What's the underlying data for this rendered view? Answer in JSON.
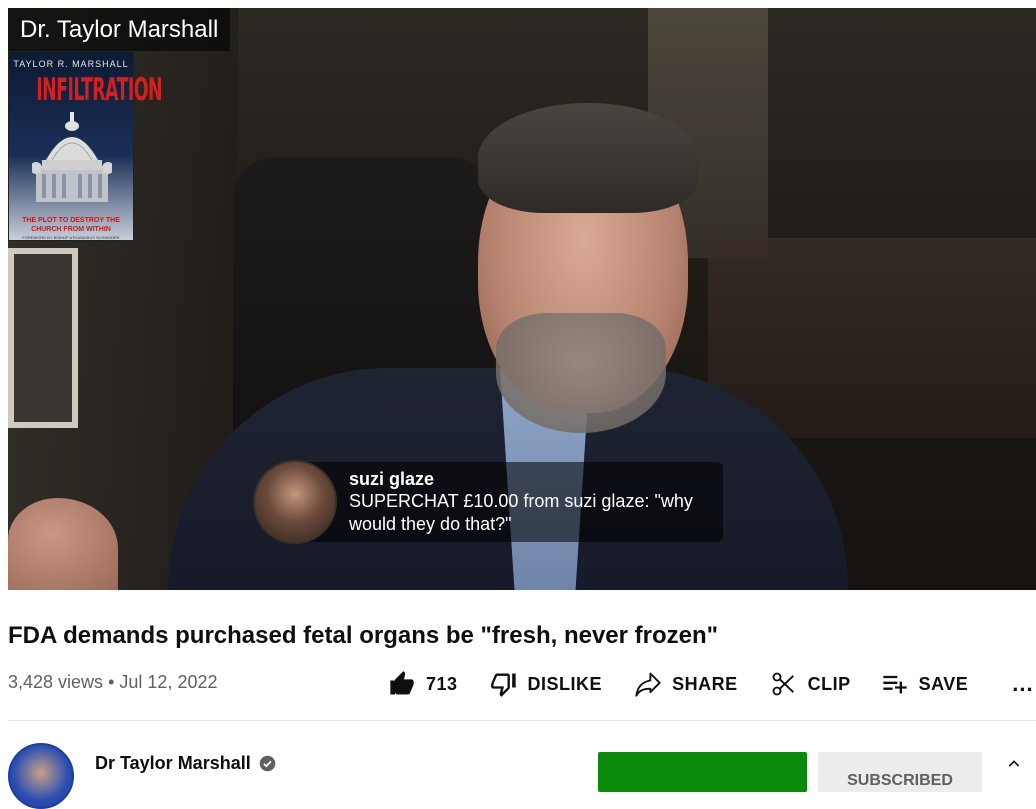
{
  "video": {
    "channel_overlay": "Dr. Taylor Marshall",
    "book": {
      "author": "TAYLOR R. MARSHALL",
      "title": "INFILTRATION",
      "subtitle_line1": "THE PLOT TO DESTROY THE",
      "subtitle_line2": "CHURCH FROM WITHIN",
      "foreword": "FOREWORD BY BISHOP ATHANASIUS SCHNEIDER"
    },
    "superchat": {
      "name": "suzi glaze",
      "message": "SUPERCHAT £10.00 from suzi glaze: \"why would they do that?\""
    }
  },
  "info": {
    "title": "FDA demands purchased fetal organs be \"fresh, never frozen\"",
    "views": "3,428 views",
    "separator": "•",
    "date": "Jul 12, 2022"
  },
  "actions": {
    "like_count": "713",
    "dislike_label": "DISLIKE",
    "share_label": "SHARE",
    "clip_label": "CLIP",
    "save_label": "SAVE",
    "more_label": "..."
  },
  "owner": {
    "name": "Dr Taylor Marshall",
    "subscribed_label": "SUBSCRIBED"
  },
  "colors": {
    "join_button": "#0a8a0a",
    "book_title": "#d3201f",
    "meta_text": "#606060"
  }
}
